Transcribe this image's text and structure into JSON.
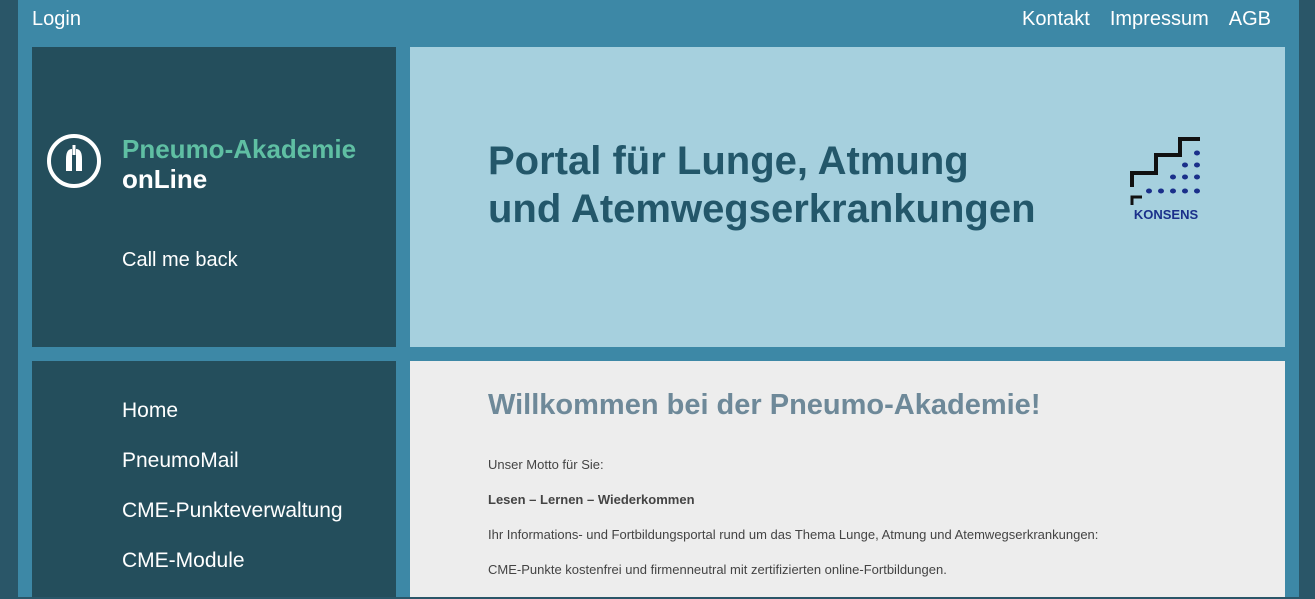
{
  "header": {
    "login_label": "Login",
    "links": [
      "Kontakt",
      "Impressum",
      "AGB"
    ]
  },
  "brand": {
    "line1": "Pneumo-Akademie",
    "line2": "onLine",
    "callback_label": "Call me back",
    "icon": "lungs-icon"
  },
  "hero": {
    "title_line1": "Portal für Lunge, Atmung",
    "title_line2": "und Atemwegserkrankungen",
    "logo_text": "KONSENS"
  },
  "nav": {
    "items": [
      "Home",
      "PneumoMail",
      "CME-Punkteverwaltung",
      "CME-Module"
    ]
  },
  "main": {
    "heading": "Willkommen bei der Pneumo-Akademie!",
    "motto_intro": "Unser Motto für Sie:",
    "motto": "Lesen – Lernen – Wiederkommen",
    "description": "Ihr Informations- und Fortbildungsportal rund um das Thema Lunge, Atmung und Atemwegserkrankungen:",
    "cme_note": "CME-Punkte kostenfrei und firmenneutral mit zertifizierten online-Fortbildungen."
  },
  "colors": {
    "outer": "#2a5668",
    "frame": "#3d88a6",
    "panel_dark": "#244e5c",
    "hero_bg": "#a6d0de",
    "brand_accent": "#5fbfa3",
    "hero_text": "#23576a",
    "heading_text": "#6e8999"
  }
}
